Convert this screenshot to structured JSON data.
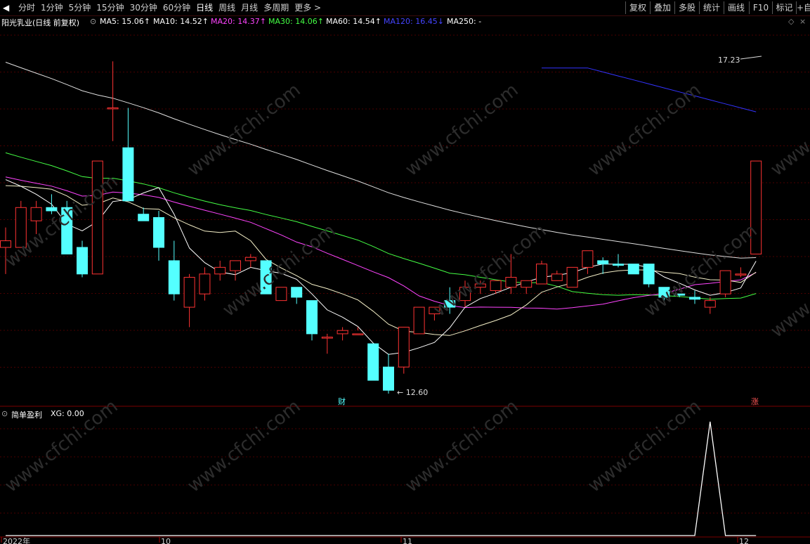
{
  "toolbar": {
    "period_tabs": [
      "分时",
      "1分钟",
      "5分钟",
      "15分钟",
      "30分钟",
      "60分钟",
      "日线",
      "周线",
      "月线",
      "多周期",
      "更多 >"
    ],
    "active_tab": "日线",
    "right_buttons": [
      "复权",
      "叠加",
      "多股",
      "统计",
      "画线",
      "F10",
      "标记",
      "+自"
    ]
  },
  "main_panel": {
    "stock_title": "阳光乳业(日线 前复权)",
    "ma_indicators": [
      {
        "label": "MA5: 15.06↑",
        "color": "#ffffff"
      },
      {
        "label": "MA10: 14.52↑",
        "color": "#ffffff"
      },
      {
        "label": "MA20: 14.37↑",
        "color": "#ff44ff"
      },
      {
        "label": "MA30: 14.06↑",
        "color": "#44ff44"
      },
      {
        "label": "MA60: 14.54↑",
        "color": "#ffffff"
      },
      {
        "label": "MA120: 16.45↓",
        "color": "#3333ff"
      },
      {
        "label": "MA250: -",
        "color": "#ffffff"
      }
    ],
    "high_marker": "17.23",
    "low_marker": "12.60",
    "event_cai": "财",
    "event_zhang": "涨"
  },
  "sub_panel": {
    "indicator_name": "简单盈利",
    "xg_value": "XG: 0.00"
  },
  "x_axis": {
    "labels": [
      "2022年",
      "10",
      "11",
      "12"
    ]
  },
  "watermark": "www.cfchi.com",
  "colors": {
    "up": "#ff3333",
    "down": "#54ffff",
    "ma5": "#ffffff",
    "ma10": "#f5f0c8",
    "ma20": "#ff44ff",
    "ma30": "#44ff44",
    "ma60": "#e0e0e0",
    "ma120": "#3333ff",
    "grid": "#4a0000"
  },
  "chart_data": {
    "type": "candlestick",
    "ohlc": [
      [
        14.2,
        14.5,
        13.8,
        14.3
      ],
      [
        14.2,
        14.9,
        14.2,
        14.8
      ],
      [
        14.6,
        14.9,
        14.4,
        14.8
      ],
      [
        14.8,
        15.0,
        14.7,
        14.75
      ],
      [
        14.8,
        14.9,
        14.1,
        14.1
      ],
      [
        14.2,
        14.3,
        13.75,
        13.8
      ],
      [
        13.8,
        15.5,
        13.8,
        15.5
      ],
      [
        16.3,
        17.0,
        15.8,
        16.3
      ],
      [
        15.7,
        16.3,
        14.9,
        14.9
      ],
      [
        14.7,
        14.8,
        14.7,
        14.6
      ],
      [
        14.65,
        14.75,
        14.0,
        14.2
      ],
      [
        14.0,
        14.3,
        13.4,
        13.5
      ],
      [
        13.3,
        13.8,
        13.0,
        13.75
      ],
      [
        13.5,
        13.9,
        13.4,
        13.8
      ],
      [
        13.8,
        14.0,
        13.7,
        13.9
      ],
      [
        13.85,
        14.0,
        13.7,
        14.0
      ],
      [
        14.0,
        14.1,
        13.9,
        14.05
      ],
      [
        14.0,
        14.0,
        13.5,
        13.5
      ],
      [
        13.4,
        13.6,
        13.5,
        13.6
      ],
      [
        13.6,
        13.5,
        13.35,
        13.45
      ],
      [
        13.4,
        13.4,
        12.8,
        12.9
      ],
      [
        12.85,
        12.9,
        12.6,
        12.85
      ],
      [
        12.9,
        13.0,
        12.8,
        12.95
      ],
      [
        12.9,
        13.0,
        12.95,
        12.9
      ],
      [
        12.75,
        12.75,
        12.2,
        12.2
      ],
      [
        12.4,
        12.6,
        12.0,
        12.05
      ],
      [
        12.4,
        13.0,
        12.3,
        13.0
      ],
      [
        12.9,
        13.3,
        13.0,
        13.3
      ],
      [
        13.2,
        13.3,
        13.1,
        13.3
      ],
      [
        13.4,
        13.6,
        13.2,
        13.3
      ],
      [
        13.4,
        13.7,
        13.3,
        13.6
      ],
      [
        13.6,
        13.7,
        13.5,
        13.65
      ],
      [
        13.55,
        13.6,
        13.5,
        13.7
      ],
      [
        13.6,
        14.1,
        13.5,
        13.75
      ],
      [
        13.6,
        13.7,
        13.5,
        13.7
      ],
      [
        13.65,
        14.0,
        13.8,
        13.95
      ],
      [
        13.7,
        13.85,
        13.7,
        13.8
      ],
      [
        13.6,
        13.9,
        13.6,
        13.9
      ],
      [
        13.9,
        14.15,
        13.8,
        14.15
      ],
      [
        14.0,
        14.05,
        13.8,
        13.95
      ],
      [
        13.95,
        14.1,
        13.9,
        13.93
      ],
      [
        13.95,
        13.9,
        13.85,
        13.8
      ],
      [
        13.95,
        13.95,
        13.6,
        13.65
      ],
      [
        13.6,
        13.6,
        13.4,
        13.45
      ],
      [
        13.5,
        13.5,
        13.45,
        13.48
      ],
      [
        13.45,
        13.55,
        13.35,
        13.42
      ],
      [
        13.3,
        13.45,
        13.2,
        13.4
      ],
      [
        13.5,
        13.85,
        13.45,
        13.85
      ],
      [
        13.8,
        13.9,
        13.75,
        13.8
      ],
      [
        14.1,
        15.5,
        14.1,
        15.5
      ]
    ],
    "xg_signal": [
      0,
      0,
      0,
      0,
      0,
      0,
      0,
      0,
      0,
      0,
      0,
      0,
      0,
      0,
      0,
      0,
      0,
      0,
      0,
      0,
      0,
      0,
      0,
      0,
      0,
      0,
      0,
      0,
      0,
      0,
      0,
      0,
      0,
      0,
      0,
      0,
      0,
      0,
      0,
      0,
      0,
      0,
      0,
      0,
      0,
      0,
      1,
      0,
      0,
      0
    ],
    "ma120_visible_from": 35
  }
}
